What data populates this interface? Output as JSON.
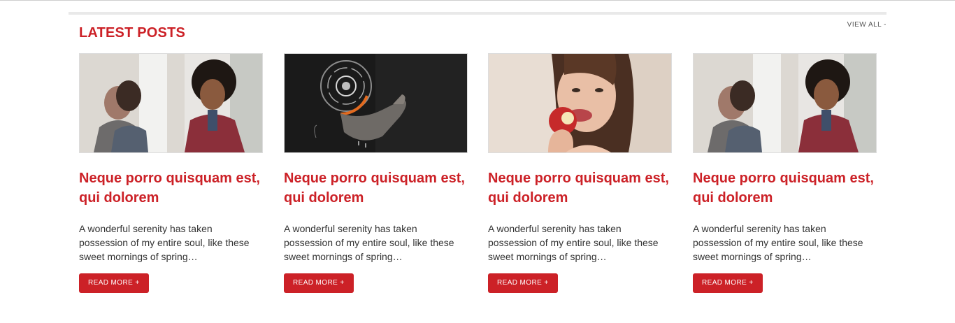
{
  "section": {
    "title": "LATEST POSTS",
    "view_all": "VIEW ALL -"
  },
  "posts": [
    {
      "title": "Neque porro quisquam est, qui dolorem",
      "excerpt": "A wonderful serenity has taken possession of my entire soul, like these sweet mornings of spring…",
      "button": "READ MORE +"
    },
    {
      "title": "Neque porro quisquam est, qui dolorem",
      "excerpt": "A wonderful serenity has taken possession of my entire soul, like these sweet mornings of spring…",
      "button": "READ MORE +"
    },
    {
      "title": "Neque porro quisquam est, qui dolorem",
      "excerpt": "A wonderful serenity has taken possession of my entire soul, like these sweet mornings of spring…",
      "button": "READ MORE +"
    },
    {
      "title": "Neque porro quisquam est, qui dolorem",
      "excerpt": "A wonderful serenity has taken possession of my entire soul, like these sweet mornings of spring…",
      "button": "READ MORE +"
    }
  ],
  "colors": {
    "accent": "#cc2127",
    "text": "#333333",
    "rule": "#e9e9e9"
  }
}
